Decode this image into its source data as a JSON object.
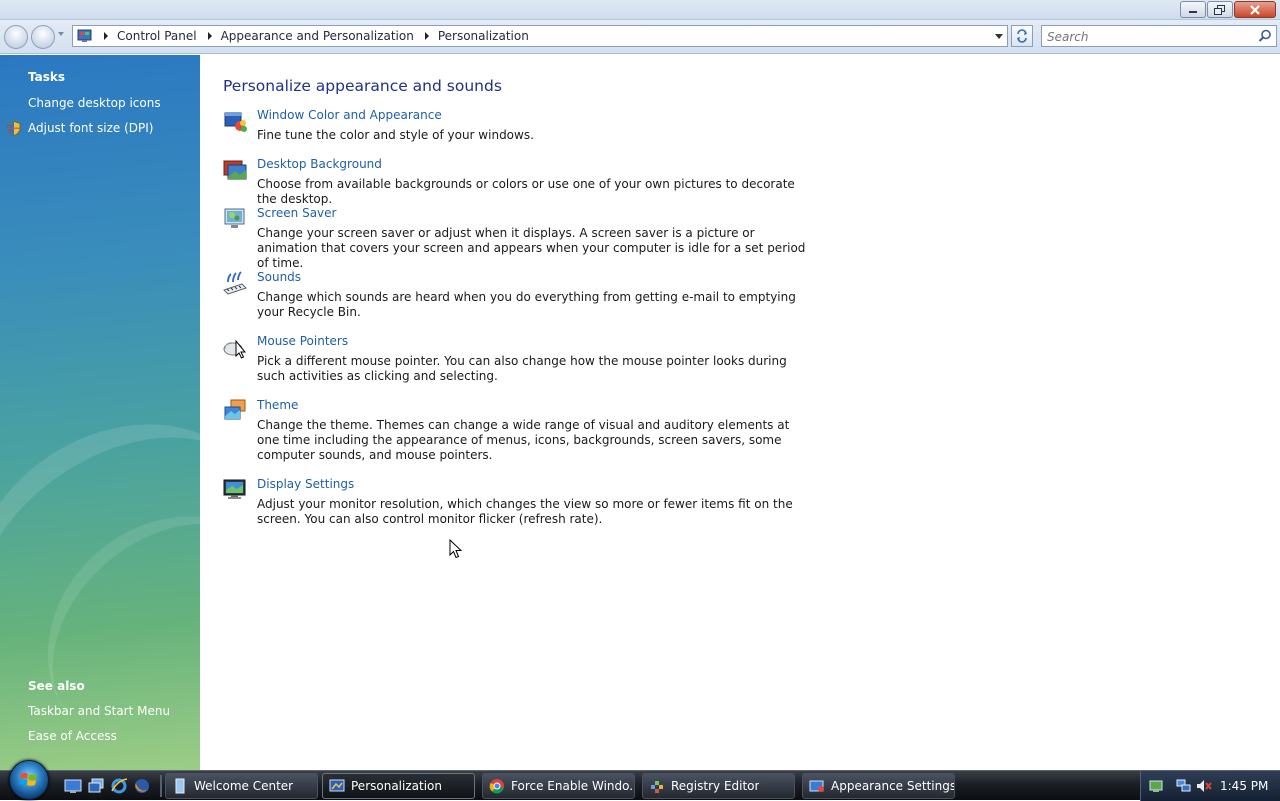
{
  "window": {
    "controls": {
      "minimize": "minimize-icon",
      "maximize": "restore-icon",
      "close": "close-icon"
    }
  },
  "address_bar": {
    "breadcrumbs": [
      "Control Panel",
      "Appearance and Personalization",
      "Personalization"
    ],
    "search_placeholder": "Search"
  },
  "sidebar": {
    "tasks_heading": "Tasks",
    "tasks": [
      {
        "label": "Change desktop icons"
      },
      {
        "label": "Adjust font size (DPI)",
        "icon": "uac-shield-icon"
      }
    ],
    "see_also_heading": "See also",
    "see_also": [
      {
        "label": "Taskbar and Start Menu"
      },
      {
        "label": "Ease of Access"
      }
    ]
  },
  "main": {
    "title": "Personalize appearance and sounds",
    "items": [
      {
        "label": "Window Color and Appearance",
        "desc": "Fine tune the color and style of your windows.",
        "icon": "window-color-icon"
      },
      {
        "label": "Desktop Background",
        "desc": "Choose from available backgrounds or colors or use one of your own pictures to decorate the desktop.",
        "icon": "desktop-background-icon"
      },
      {
        "label": "Screen Saver",
        "desc": "Change your screen saver or adjust when it displays. A screen saver is a picture or animation that covers your screen and appears when your computer is idle for a set period of time.",
        "icon": "screen-saver-icon"
      },
      {
        "label": "Sounds",
        "desc": "Change which sounds are heard when you do everything from getting e-mail to emptying your Recycle Bin.",
        "icon": "sounds-icon"
      },
      {
        "label": "Mouse Pointers",
        "desc": "Pick a different mouse pointer. You can also change how the mouse pointer looks during such activities as clicking and selecting.",
        "icon": "mouse-pointers-icon"
      },
      {
        "label": "Theme",
        "desc": "Change the theme. Themes can change a wide range of visual and auditory elements at one time including the appearance of menus, icons, backgrounds, screen savers, some computer sounds, and mouse pointers.",
        "icon": "theme-icon"
      },
      {
        "label": "Display Settings",
        "desc": "Adjust your monitor resolution, which changes the view so more or fewer items fit on the screen. You can also control monitor flicker (refresh rate).",
        "icon": "display-settings-icon"
      }
    ]
  },
  "taskbar": {
    "tasks": [
      {
        "label": "Welcome Center",
        "active": false
      },
      {
        "label": "Personalization",
        "active": true
      },
      {
        "label": "Force Enable Windo...",
        "active": false
      },
      {
        "label": "Registry Editor",
        "active": false
      },
      {
        "label": "Appearance Settings",
        "active": false
      }
    ],
    "clock": "1:45 PM"
  }
}
